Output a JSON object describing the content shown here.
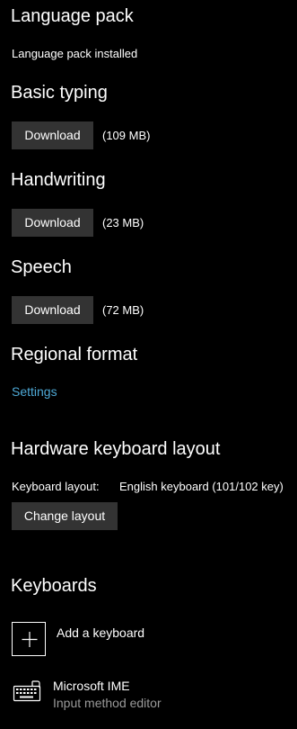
{
  "language_pack": {
    "title": "Language pack",
    "status": "Language pack installed"
  },
  "basic_typing": {
    "title": "Basic typing",
    "button_label": "Download",
    "size": "(109 MB)"
  },
  "handwriting": {
    "title": "Handwriting",
    "button_label": "Download",
    "size": "(23 MB)"
  },
  "speech": {
    "title": "Speech",
    "button_label": "Download",
    "size": "(72 MB)"
  },
  "regional_format": {
    "title": "Regional format",
    "link_label": "Settings"
  },
  "hardware_keyboard": {
    "title": "Hardware keyboard layout",
    "layout_label": "Keyboard layout:",
    "layout_value": "English keyboard (101/102 key)",
    "button_label": "Change layout"
  },
  "keyboards": {
    "title": "Keyboards",
    "add_label": "Add a keyboard",
    "items": [
      {
        "name": "Microsoft IME",
        "description": "Input method editor",
        "icon": "keyboard-icon"
      }
    ]
  },
  "colors": {
    "background": "#000000",
    "button": "#333333",
    "link": "#4ea9d6",
    "secondary_text": "#9a9a9a"
  }
}
